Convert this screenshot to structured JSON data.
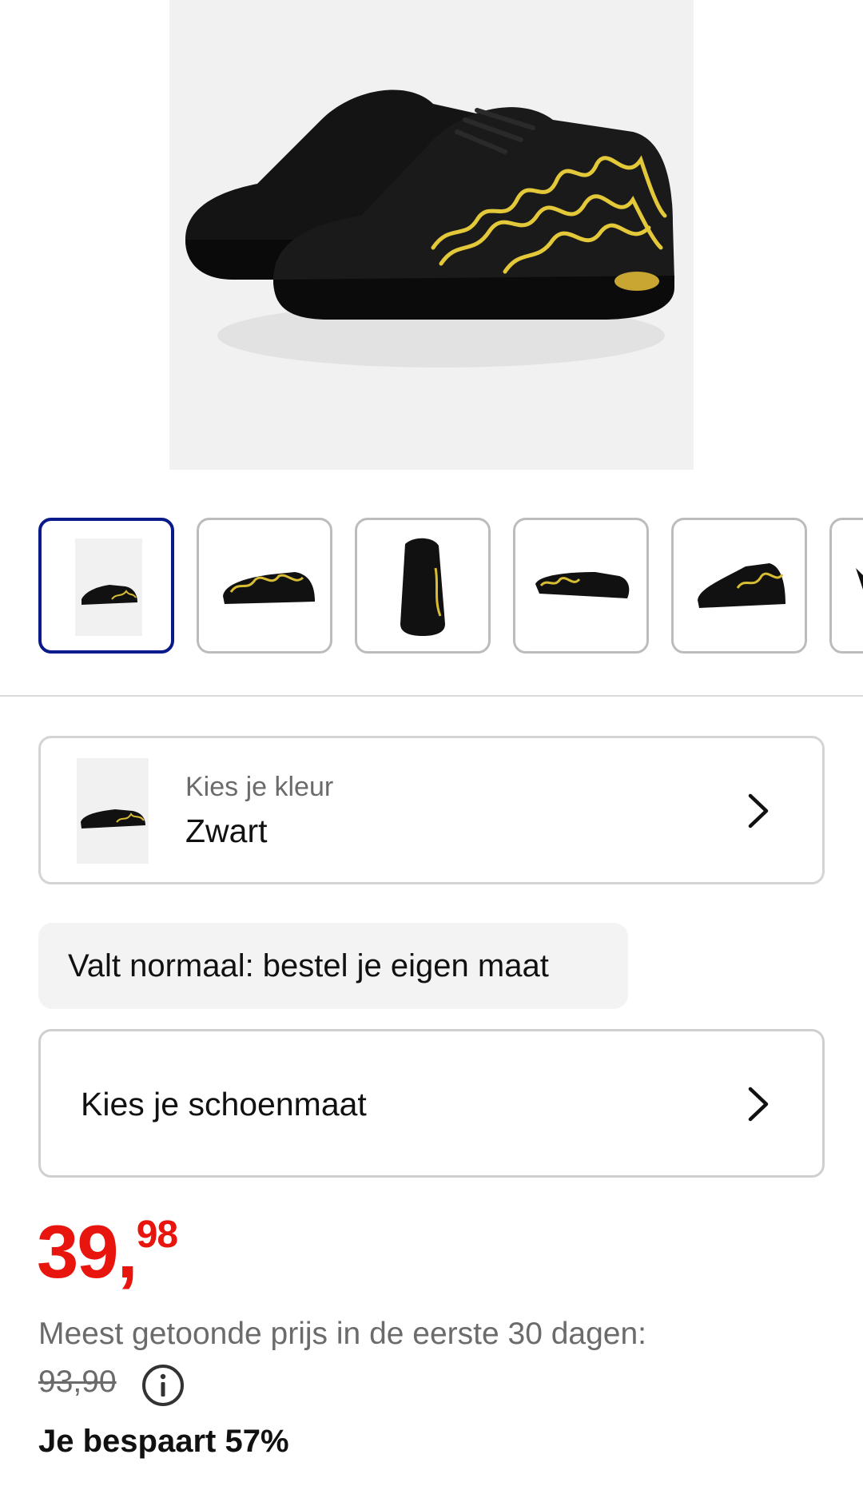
{
  "product": {
    "image_alt": "zwarte sneaker met gouden hartjesprint"
  },
  "gallery": {
    "thumbnails": [
      "thumb-1",
      "thumb-2",
      "thumb-3",
      "thumb-4",
      "thumb-5"
    ],
    "active_index": 0
  },
  "color": {
    "label": "Kies je kleur",
    "value": "Zwart"
  },
  "fit": {
    "text": "Valt normaal: bestel je eigen maat"
  },
  "size": {
    "label": "Kies je schoenmaat"
  },
  "price": {
    "euros": "39,",
    "cents": "98",
    "color": "#e8140e"
  },
  "reference": {
    "text": "Meest getoonde prijs in de eerste 30 dagen:",
    "old_price": "93,90"
  },
  "savings": {
    "text": "Je bespaart 57%"
  },
  "icons": {
    "chevron": "chevron-right-icon",
    "info": "info-icon"
  }
}
